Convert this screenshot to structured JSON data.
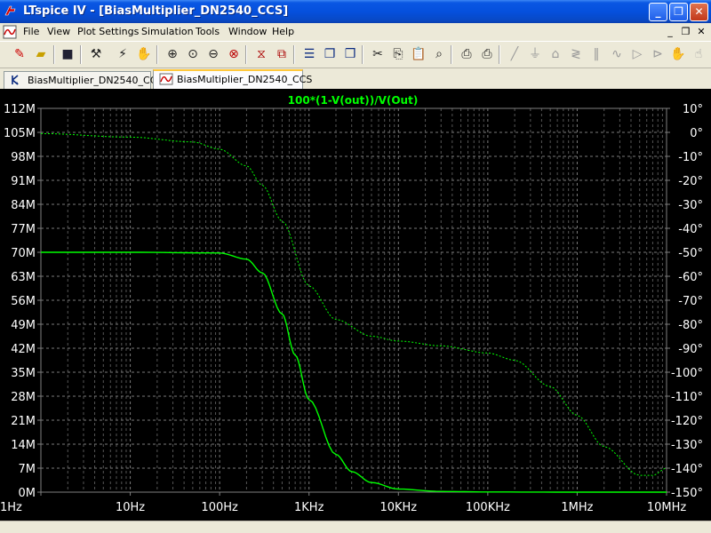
{
  "window": {
    "title": "LTspice IV - [BiasMultiplier_DN2540_CCS]",
    "minimize_glyph": "_",
    "restore_glyph": "❐",
    "close_glyph": "✕"
  },
  "menu": {
    "items": [
      "File",
      "View",
      "Plot Settings",
      "Simulation",
      "Tools",
      "Window",
      "Help"
    ],
    "mdi_minimize": "_",
    "mdi_restore": "❐",
    "mdi_close": "✕"
  },
  "toolbar": {
    "icons": [
      "open-schematic-icon",
      "open-file-icon",
      "save-icon",
      "control-panel-icon",
      "run-icon",
      "halt-icon",
      "zoom-in-icon",
      "zoom-box-icon",
      "zoom-out-icon",
      "zoom-cancel-icon",
      "autorange-icon",
      "fit-icon",
      "tile-horizontal-icon",
      "cascade-icon",
      "tile-vertical-icon",
      "cut-icon",
      "copy-icon",
      "paste-icon",
      "find-icon",
      "print-preview-icon",
      "print-icon",
      "wire-icon",
      "ground-icon",
      "label-icon",
      "resistor-icon",
      "capacitor-icon",
      "inductor-icon",
      "diode-icon",
      "component-icon",
      "move-icon",
      "drag-icon"
    ]
  },
  "tabs": [
    {
      "label": "BiasMultiplier_DN2540_CCS",
      "type": "schematic",
      "active": false
    },
    {
      "label": "BiasMultiplier_DN2540_CCS",
      "type": "waveform",
      "active": true
    }
  ],
  "plot": {
    "trace_label": "100*(1-V(out))/V(Out)",
    "trace_color": "#00ff00",
    "background": "#000000",
    "left_ticks": [
      "112M",
      "105M",
      "98M",
      "91M",
      "84M",
      "77M",
      "70M",
      "63M",
      "56M",
      "49M",
      "42M",
      "35M",
      "28M",
      "21M",
      "14M",
      "7M",
      "0M"
    ],
    "right_ticks": [
      "10°",
      "0°",
      "-10°",
      "-20°",
      "-30°",
      "-40°",
      "-50°",
      "-60°",
      "-70°",
      "-80°",
      "-90°",
      "-100°",
      "-110°",
      "-120°",
      "-130°",
      "-140°",
      "-150°"
    ],
    "x_ticks": [
      "1Hz",
      "10Hz",
      "100Hz",
      "1KHz",
      "10KHz",
      "100KHz",
      "1MHz",
      "10MHz"
    ]
  },
  "chart_data": {
    "type": "line",
    "title": "100*(1-V(out))/V(Out)",
    "xscale": "log",
    "xlim": [
      1,
      10000000
    ],
    "ylim": [
      0,
      112000000
    ],
    "y2lim": [
      -150,
      10
    ],
    "grid": true,
    "series": [
      {
        "style": "solid",
        "axis": "left",
        "x": [
          1,
          10,
          100,
          200,
          300,
          500,
          700,
          1000,
          2000,
          3000,
          5000,
          10000,
          30000,
          100000,
          1000000,
          10000000
        ],
        "y": [
          70000000,
          70000000,
          69800000,
          68000000,
          64000000,
          52000000,
          40000000,
          27000000,
          11000000,
          6000000,
          2800000,
          900000,
          200000,
          50000,
          0,
          0
        ]
      },
      {
        "style": "dashed",
        "axis": "right",
        "x": [
          1,
          10,
          50,
          100,
          200,
          300,
          500,
          1000,
          2000,
          5000,
          10000,
          30000,
          100000,
          200000,
          500000,
          1000000,
          2000000,
          5000000,
          7000000,
          10000000
        ],
        "y": [
          -0.5,
          -2,
          -4,
          -7,
          -14,
          -22,
          -37,
          -64,
          -78,
          -85,
          -87,
          -89,
          -92,
          -95,
          -106,
          -118,
          -131,
          -143,
          -143,
          -140
        ]
      }
    ]
  }
}
